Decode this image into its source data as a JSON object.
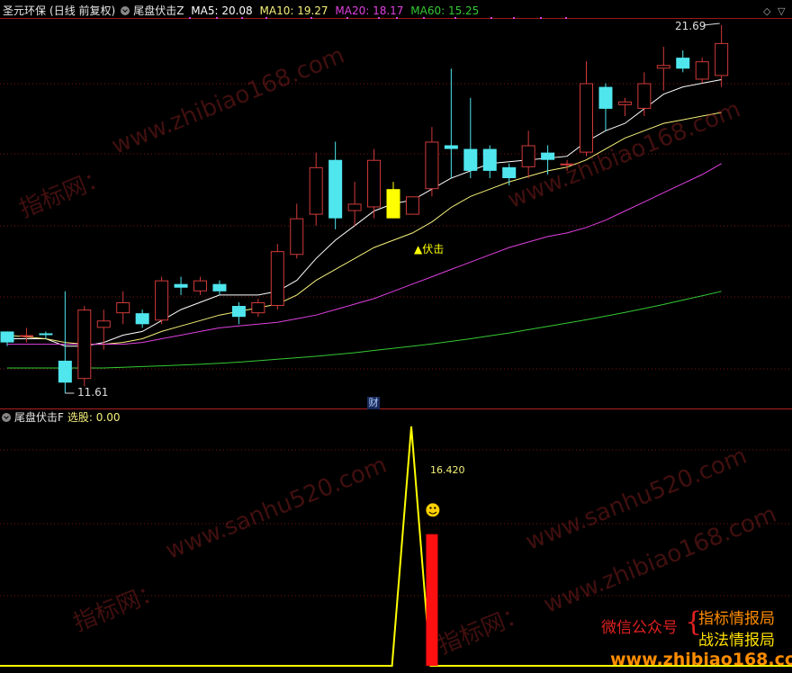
{
  "top_panel": {
    "stock_name": "圣元环保",
    "period_label": "(日线 前复权)",
    "indicator_name": "尾盘伏击Z",
    "ma5": "MA5: 20.08",
    "ma10": "MA10: 19.27",
    "ma20": "MA20: 18.17",
    "ma60": "MA60: 15.25",
    "high_label": "21.69",
    "low_label": "11.61",
    "signal_label": "▲伏击",
    "finance_marker": "财"
  },
  "bottom_panel": {
    "indicator_name": "尾盘伏击F",
    "select_label": "选股: 0.00",
    "peak_value_label": "16.420",
    "smiley": "☻"
  },
  "watermarks": {
    "wm1": "www.zhibiao168.com",
    "wm2": "指标网：",
    "wm3": "www.zhibiao168.com",
    "wm4": "www.sanhu520.com",
    "wm5": "www.sanhu520.com",
    "wm6": "指标网：",
    "wm7": "www.zhibiao168.com",
    "wm8": "指标网："
  },
  "promo": {
    "wechat_label": "微信公众号",
    "line1": "指标情报局",
    "line2": "战法情报局",
    "website": "www.zhibiao168.com"
  },
  "colors": {
    "up": "#d03a3a",
    "down": "#4fe6ee",
    "ma5": "#ffffff",
    "ma10": "#f5f07a",
    "ma20": "#e040e0",
    "ma60": "#34c934",
    "signal": "#ffff00",
    "grid": "#7a1515"
  },
  "chart_data": {
    "type": "candlestick",
    "candles": [
      {
        "o": 13.3,
        "c": 13.0,
        "h": 13.3,
        "l": 12.9
      },
      {
        "o": 13.2,
        "c": 13.2,
        "h": 13.4,
        "l": 13.0
      },
      {
        "o": 13.25,
        "c": 13.2,
        "h": 13.3,
        "l": 13.1
      },
      {
        "o": 12.5,
        "c": 11.9,
        "h": 14.4,
        "l": 11.61
      },
      {
        "o": 12.0,
        "c": 13.9,
        "h": 14.0,
        "l": 11.8
      },
      {
        "o": 13.4,
        "c": 13.6,
        "h": 13.9,
        "l": 12.8
      },
      {
        "o": 13.8,
        "c": 14.1,
        "h": 14.4,
        "l": 13.5
      },
      {
        "o": 13.8,
        "c": 13.5,
        "h": 13.9,
        "l": 13.4
      },
      {
        "o": 13.6,
        "c": 14.7,
        "h": 14.8,
        "l": 13.5
      },
      {
        "o": 14.6,
        "c": 14.5,
        "h": 14.8,
        "l": 14.3
      },
      {
        "o": 14.4,
        "c": 14.7,
        "h": 14.8,
        "l": 14.3
      },
      {
        "o": 14.6,
        "c": 14.4,
        "h": 14.7,
        "l": 14.3
      },
      {
        "o": 14.0,
        "c": 13.7,
        "h": 14.1,
        "l": 13.5
      },
      {
        "o": 13.8,
        "c": 14.1,
        "h": 14.2,
        "l": 13.7
      },
      {
        "o": 14.0,
        "c": 15.5,
        "h": 15.7,
        "l": 13.9
      },
      {
        "o": 15.4,
        "c": 16.4,
        "h": 16.8,
        "l": 15.3
      },
      {
        "o": 16.5,
        "c": 17.8,
        "h": 18.2,
        "l": 16.2
      },
      {
        "o": 18.0,
        "c": 16.4,
        "h": 18.5,
        "l": 16.1
      },
      {
        "o": 16.6,
        "c": 16.8,
        "h": 17.4,
        "l": 16.2
      },
      {
        "o": 16.7,
        "c": 18.0,
        "h": 18.3,
        "l": 16.4
      },
      {
        "o": 17.2,
        "c": 16.4,
        "h": 17.4,
        "l": 16.4
      },
      {
        "o": 16.5,
        "c": 17.0,
        "h": 17.0,
        "l": 16.5
      },
      {
        "o": 17.2,
        "c": 18.5,
        "h": 18.9,
        "l": 17.0
      },
      {
        "o": 18.4,
        "c": 18.3,
        "h": 20.5,
        "l": 17.5
      },
      {
        "o": 18.3,
        "c": 17.7,
        "h": 19.7,
        "l": 17.5
      },
      {
        "o": 18.3,
        "c": 17.7,
        "h": 18.4,
        "l": 17.5
      },
      {
        "o": 17.8,
        "c": 17.5,
        "h": 17.9,
        "l": 17.3
      },
      {
        "o": 17.8,
        "c": 18.4,
        "h": 18.8,
        "l": 17.5
      },
      {
        "o": 18.2,
        "c": 18.0,
        "h": 18.4,
        "l": 17.6
      },
      {
        "o": 17.9,
        "c": 17.9,
        "h": 18.0,
        "l": 17.7
      },
      {
        "o": 18.2,
        "c": 20.1,
        "h": 20.7,
        "l": 18.1
      },
      {
        "o": 20.0,
        "c": 19.4,
        "h": 20.1,
        "l": 18.8
      },
      {
        "o": 19.5,
        "c": 19.6,
        "h": 19.7,
        "l": 19.2
      },
      {
        "o": 19.4,
        "c": 20.1,
        "h": 20.4,
        "l": 19.2
      },
      {
        "o": 20.5,
        "c": 20.6,
        "h": 21.1,
        "l": 19.9
      },
      {
        "o": 20.8,
        "c": 20.5,
        "h": 21.0,
        "l": 20.4
      },
      {
        "o": 20.2,
        "c": 20.7,
        "h": 20.8,
        "l": 20.1
      },
      {
        "o": 20.3,
        "c": 21.2,
        "h": 21.69,
        "l": 20.0
      }
    ],
    "signal_candle_index": 20,
    "ma_series": [
      {
        "name": "MA5",
        "values": [
          13.1,
          13.1,
          13.1,
          12.9,
          12.9,
          13.0,
          13.2,
          13.3,
          13.6,
          13.9,
          14.1,
          14.3,
          14.3,
          14.3,
          14.4,
          14.7,
          15.3,
          15.8,
          16.2,
          16.6,
          16.8,
          16.9,
          17.2,
          17.5,
          17.7,
          17.9,
          17.95,
          18.0,
          18.05,
          18.1,
          18.5,
          18.8,
          19.0,
          19.4,
          19.8,
          20.0,
          20.1,
          20.2
        ]
      },
      {
        "name": "MA10",
        "values": [
          13.2,
          13.15,
          13.1,
          13.0,
          12.95,
          12.95,
          13.0,
          13.1,
          13.3,
          13.45,
          13.6,
          13.75,
          13.85,
          13.95,
          14.05,
          14.3,
          14.7,
          15.0,
          15.3,
          15.6,
          15.8,
          16.0,
          16.3,
          16.7,
          17.0,
          17.2,
          17.4,
          17.55,
          17.7,
          17.8,
          18.0,
          18.3,
          18.6,
          18.8,
          19.0,
          19.1,
          19.2,
          19.3
        ]
      },
      {
        "name": "MA20",
        "values": [
          12.95,
          12.95,
          12.95,
          12.95,
          12.95,
          12.95,
          12.95,
          13.0,
          13.1,
          13.2,
          13.3,
          13.4,
          13.45,
          13.5,
          13.55,
          13.65,
          13.75,
          13.9,
          14.05,
          14.2,
          14.4,
          14.6,
          14.8,
          15.0,
          15.2,
          15.4,
          15.6,
          15.75,
          15.9,
          16.0,
          16.15,
          16.35,
          16.6,
          16.85,
          17.1,
          17.35,
          17.6,
          17.9
        ]
      },
      {
        "name": "MA60",
        "values": [
          12.3,
          12.3,
          12.3,
          12.3,
          12.3,
          12.3,
          12.32,
          12.34,
          12.36,
          12.38,
          12.4,
          12.43,
          12.46,
          12.5,
          12.54,
          12.58,
          12.62,
          12.67,
          12.72,
          12.78,
          12.84,
          12.9,
          12.96,
          13.03,
          13.1,
          13.18,
          13.26,
          13.35,
          13.44,
          13.53,
          13.62,
          13.72,
          13.82,
          13.93,
          14.04,
          14.16,
          14.28,
          14.4
        ]
      }
    ],
    "bottom_line": {
      "x_index": [
        0,
        19,
        20,
        21,
        37
      ],
      "values": [
        0,
        0,
        1,
        0,
        0
      ]
    },
    "bottom_bar": {
      "x_index": 21,
      "value": 0.55
    }
  }
}
